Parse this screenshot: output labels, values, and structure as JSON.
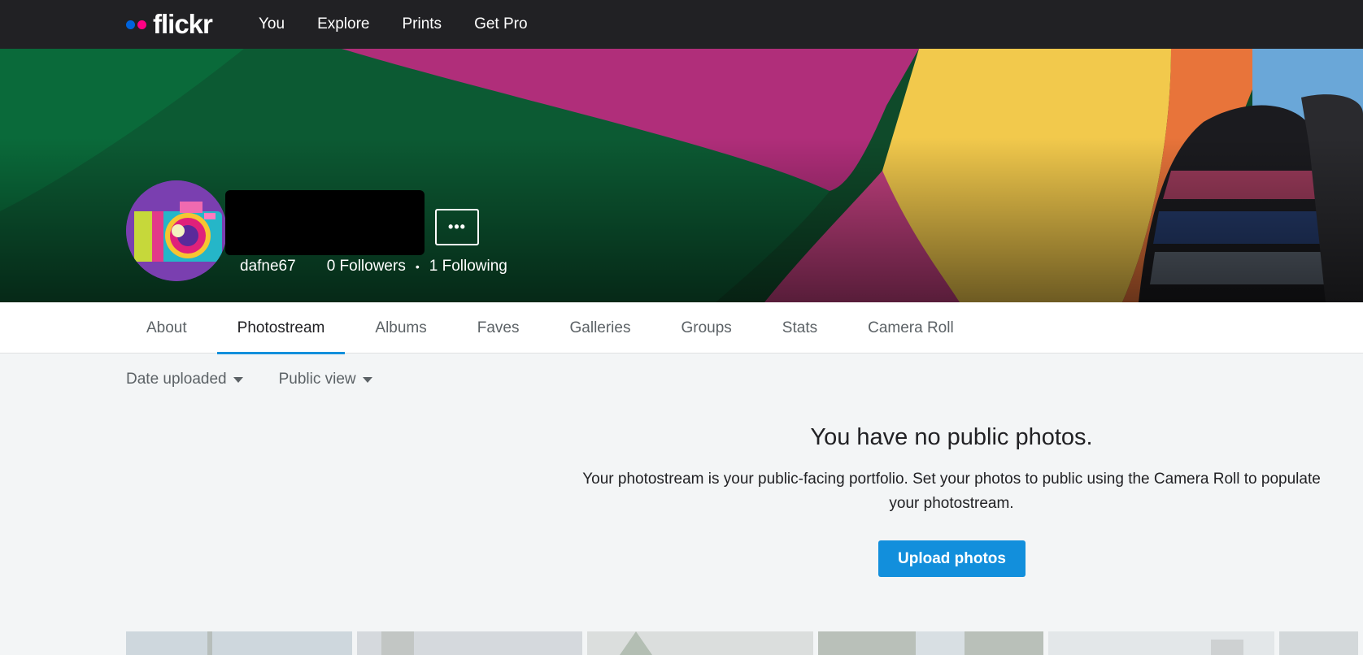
{
  "topnav": {
    "logo_text": "flickr",
    "links": [
      "You",
      "Explore",
      "Prints",
      "Get Pro"
    ]
  },
  "profile": {
    "username": "dafne67",
    "followers": "0 Followers",
    "separator": "•",
    "following": "1 Following",
    "more_label": "•••"
  },
  "subnav": {
    "tabs": [
      "About",
      "Photostream",
      "Albums",
      "Faves",
      "Galleries",
      "Groups",
      "Stats",
      "Camera Roll"
    ],
    "active": "Photostream"
  },
  "filters": {
    "sort": "Date uploaded",
    "view": "Public view"
  },
  "empty_state": {
    "title": "You have no public photos.",
    "body": "Your photostream is your public-facing portfolio. Set your photos to public using the Camera Roll to populate your photostream.",
    "button": "Upload photos"
  },
  "colors": {
    "accent": "#128fdc",
    "nav_bg": "#212124",
    "flickr_blue": "#0063dc",
    "flickr_pink": "#ff0084"
  }
}
